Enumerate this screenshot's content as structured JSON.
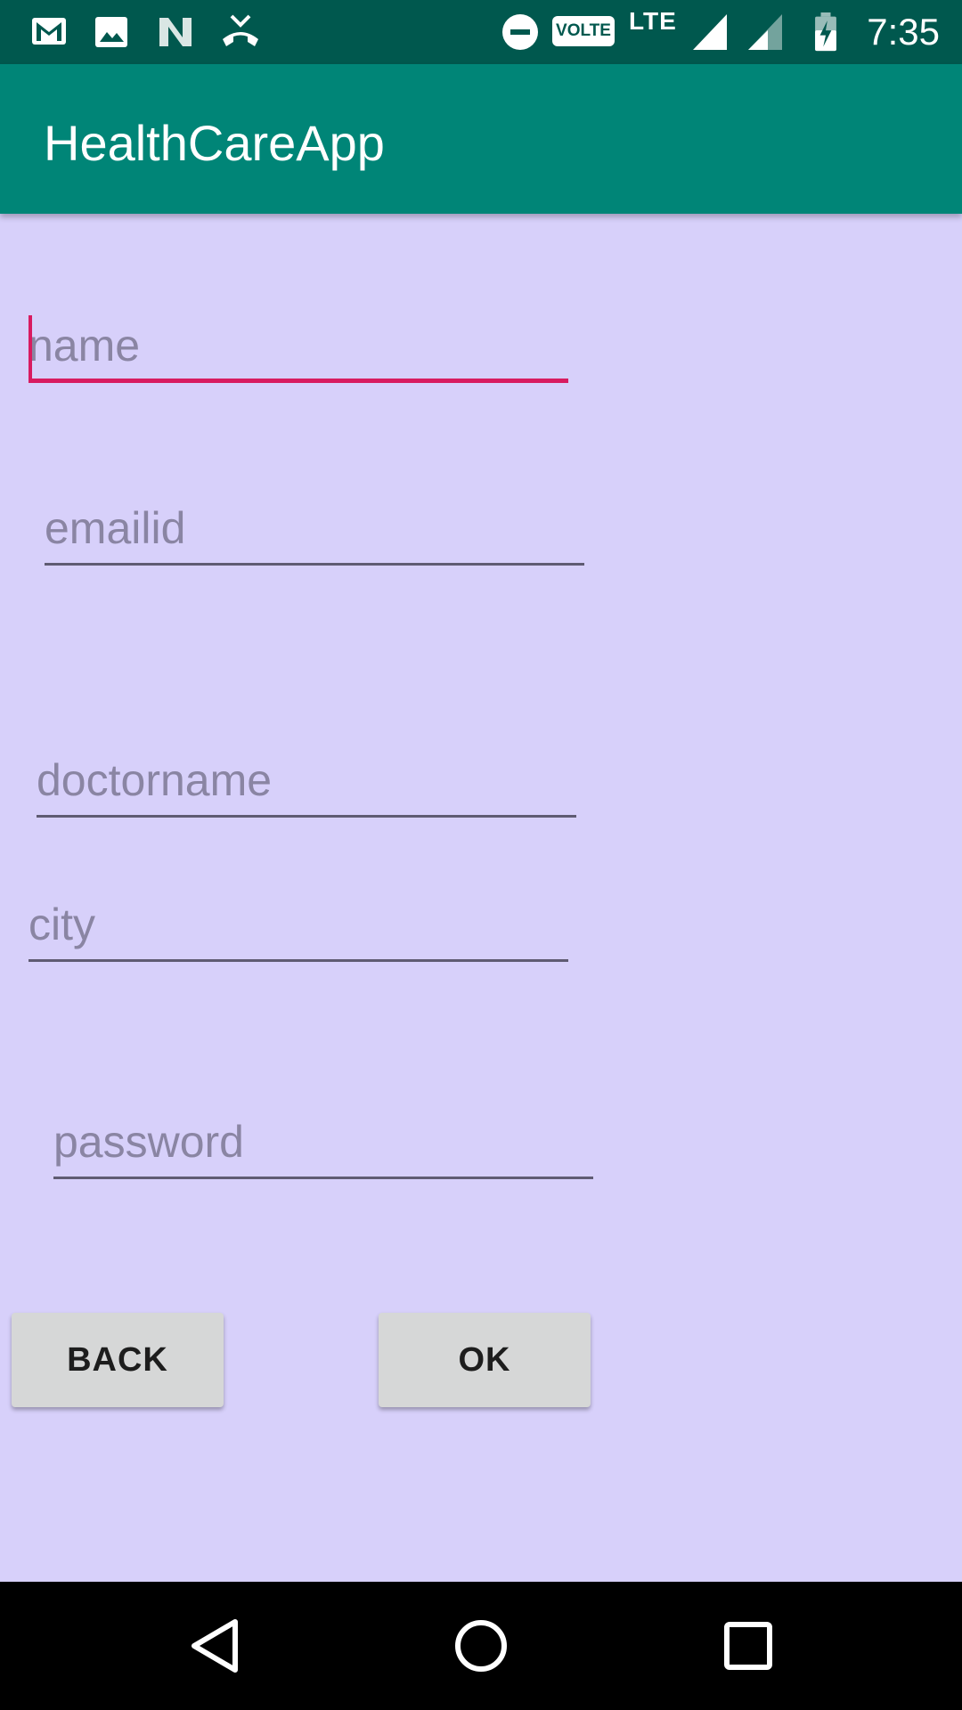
{
  "status_bar": {
    "time": "7:35",
    "network": "LTE",
    "volte": "VOLTE",
    "icons": [
      "gmail-icon",
      "image-icon",
      "n-app-icon",
      "missed-call-icon",
      "do-not-disturb-icon",
      "volte-icon",
      "signal-icon",
      "signal-secondary-icon",
      "battery-charging-icon"
    ]
  },
  "app_bar": {
    "title": "HealthCareApp"
  },
  "form": {
    "name_placeholder": "name",
    "name_value": "",
    "email_placeholder": "emailid",
    "email_value": "",
    "doctor_placeholder": "doctorname",
    "doctor_value": "",
    "city_placeholder": "city",
    "city_value": "",
    "password_placeholder": "password",
    "password_value": ""
  },
  "buttons": {
    "back_label": "BACK",
    "ok_label": "OK"
  },
  "nav_bar": {
    "icons": [
      "back-triangle-icon",
      "home-circle-icon",
      "recents-square-icon"
    ]
  },
  "colors": {
    "status_bar": "#00584e",
    "app_bar": "#008577",
    "background": "#d7d0fa",
    "accent": "#d81b60",
    "button": "#d6d7d7"
  }
}
